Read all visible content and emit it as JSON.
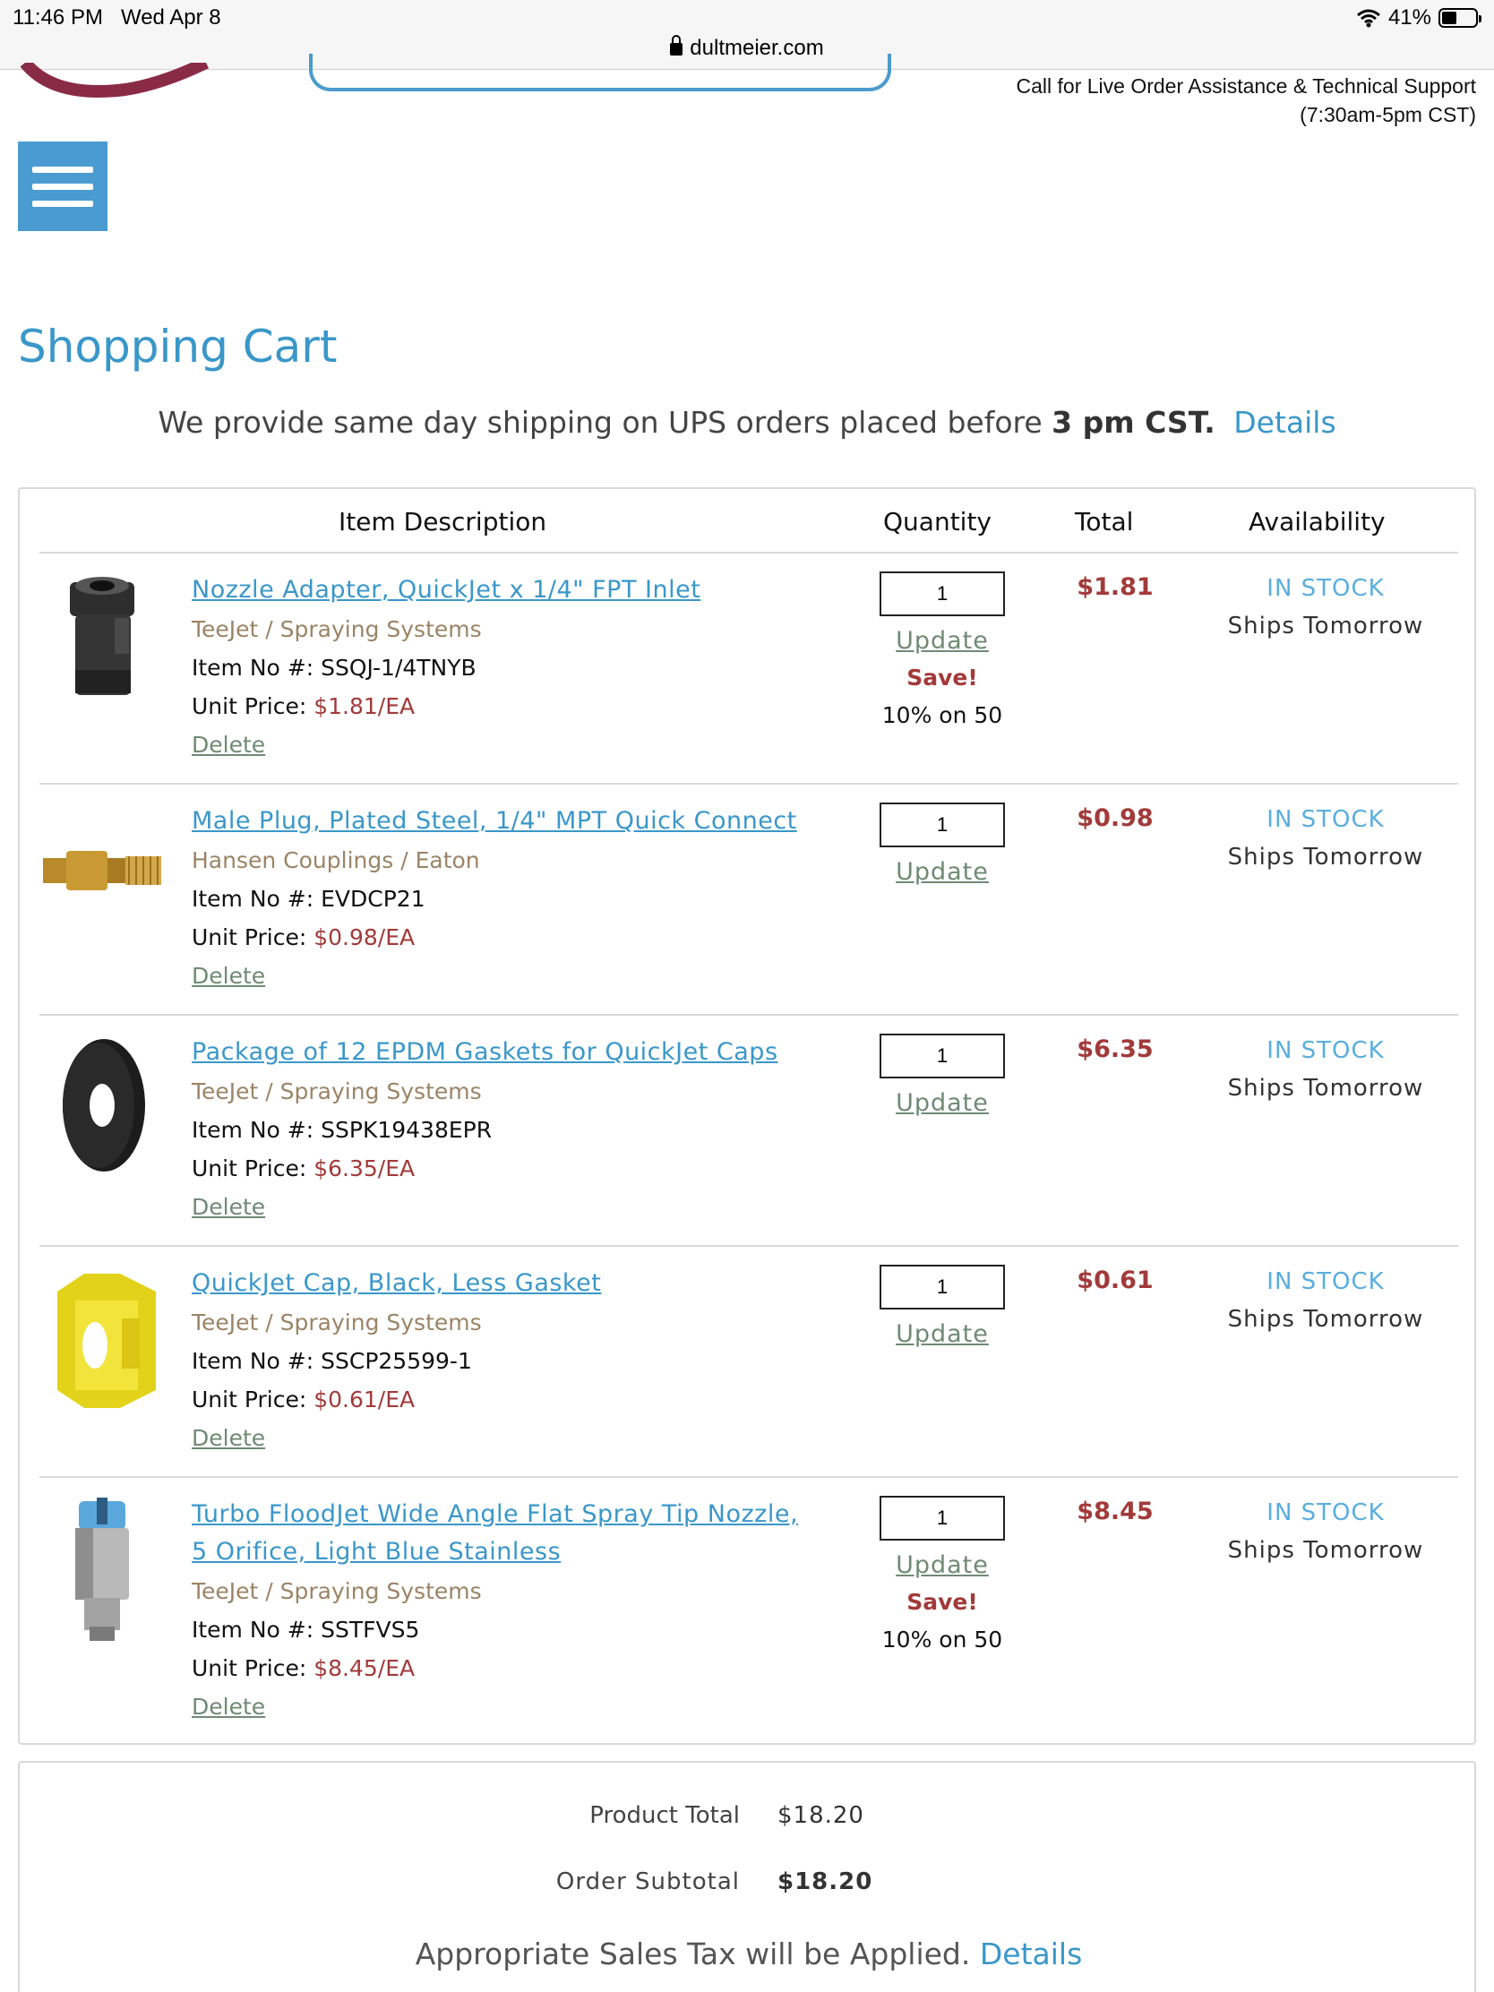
{
  "status_bar": {
    "time": "11:46 PM",
    "date": "Wed Apr 8",
    "battery": "41%"
  },
  "browser": {
    "url": "dultmeier.com"
  },
  "header": {
    "support_line1": "Call for Live Order Assistance & Technical Support",
    "support_line2": "(7:30am-5pm CST)"
  },
  "page": {
    "title": "Shopping Cart",
    "shipping_prefix": "We provide same day shipping on UPS orders placed before",
    "shipping_time": "3 pm CST.",
    "shipping_link": "Details"
  },
  "table": {
    "headers": {
      "description": "Item Description",
      "quantity": "Quantity",
      "total": "Total",
      "availability": "Availability"
    },
    "labels": {
      "item_no": "Item No #:",
      "unit_price": "Unit Price:",
      "delete": "Delete",
      "update": "Update",
      "save": "Save!"
    },
    "items": [
      {
        "name": "Nozzle Adapter, QuickJet x 1/4\" FPT Inlet",
        "brand": "TeeJet / Spraying Systems",
        "item_no": "SSQJ-1/4TNYB",
        "unit_price": "$1.81/EA",
        "qty": "1",
        "total": "$1.81",
        "stock": "IN STOCK",
        "ships": "Ships Tomorrow",
        "save_note": "10% on 50"
      },
      {
        "name": "Male Plug, Plated Steel, 1/4\" MPT Quick Connect",
        "brand": "Hansen Couplings / Eaton",
        "item_no": "EVDCP21",
        "unit_price": "$0.98/EA",
        "qty": "1",
        "total": "$0.98",
        "stock": "IN STOCK",
        "ships": "Ships Tomorrow"
      },
      {
        "name": "Package of 12 EPDM Gaskets for QuickJet Caps",
        "brand": "TeeJet / Spraying Systems",
        "item_no": "SSPK19438EPR",
        "unit_price": "$6.35/EA",
        "qty": "1",
        "total": "$6.35",
        "stock": "IN STOCK",
        "ships": "Ships Tomorrow"
      },
      {
        "name": "QuickJet Cap, Black, Less Gasket",
        "brand": "TeeJet / Spraying Systems",
        "item_no": "SSCP25599-1",
        "unit_price": "$0.61/EA",
        "qty": "1",
        "total": "$0.61",
        "stock": "IN STOCK",
        "ships": "Ships Tomorrow"
      },
      {
        "name_line1": "Turbo FloodJet Wide Angle Flat Spray Tip Nozzle,",
        "name_line2": "5 Orifice, Light Blue Stainless",
        "brand": "TeeJet / Spraying Systems",
        "item_no": "SSTFVS5",
        "unit_price": "$8.45/EA",
        "qty": "1",
        "total": "$8.45",
        "stock": "IN STOCK",
        "ships": "Ships Tomorrow",
        "save_note": "10% on 50"
      }
    ]
  },
  "summary": {
    "product_total_label": "Product Total",
    "product_total": "$18.20",
    "order_subtotal_label": "Order Subtotal",
    "order_subtotal": "$18.20",
    "tax_text": "Appropriate Sales Tax will be Applied.",
    "tax_link": "Details"
  },
  "colors": {
    "accent": "#3a97c9",
    "price": "#a23a3a",
    "brand": "#9b8466",
    "link_green": "#6f8a74",
    "menu": "#4a9bd1"
  }
}
